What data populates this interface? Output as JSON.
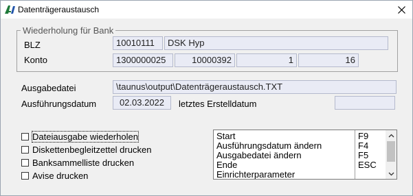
{
  "window": {
    "title": "Datenträgeraustausch",
    "icon": "app-logo-icon",
    "close_icon": "close-icon"
  },
  "group": {
    "legend": "Wiederholung für Bank",
    "blz_label": "BLZ",
    "blz_value": "10010111",
    "bank_name": "DSK Hyp",
    "konto_label": "Konto",
    "konto_1": "1300000025",
    "konto_2": "10000392",
    "konto_3": "1",
    "konto_4": "16"
  },
  "ausgabedatei": {
    "label": "Ausgabedatei",
    "value": "\\taunus\\output\\Datenträgeraustausch.TXT"
  },
  "ausfuehrung": {
    "label": "Ausführungsdatum",
    "value": "02.03.2022",
    "letztes_label": "letztes Erstelldatum",
    "letztes_value": ""
  },
  "checkboxes": [
    {
      "label": "Dateiausgabe wiederholen",
      "checked": false,
      "focused": true
    },
    {
      "label": "Diskettenbegleitzettel drucken",
      "checked": false
    },
    {
      "label": "Banksammelliste drucken",
      "checked": false
    },
    {
      "label": "Avise drucken",
      "checked": false
    }
  ],
  "commands": [
    {
      "name": "Start",
      "key": "F9"
    },
    {
      "name": "Ausführungsdatum ändern",
      "key": "F4"
    },
    {
      "name": "Ausgabedatei ändern",
      "key": "F5"
    },
    {
      "name": "Ende",
      "key": "ESC"
    },
    {
      "name": "Einrichterparameter",
      "key": ""
    }
  ]
}
